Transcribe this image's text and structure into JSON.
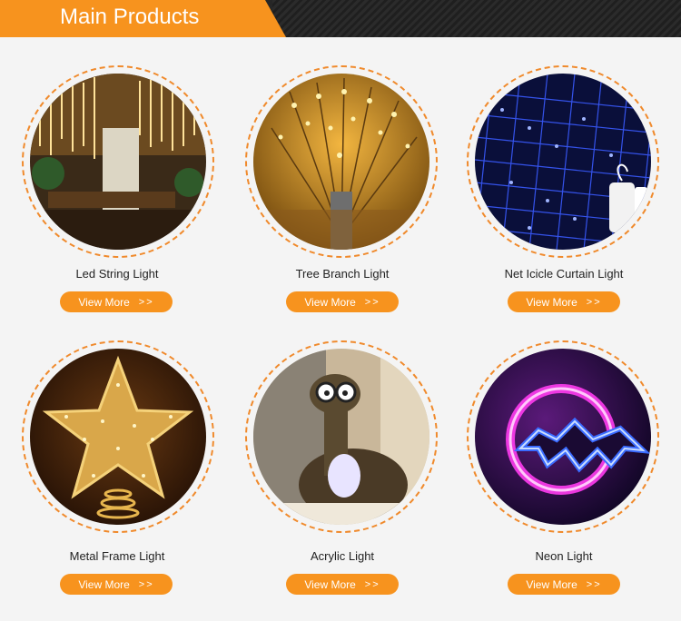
{
  "header": {
    "title": "Main Products"
  },
  "products": [
    {
      "name": "Led String Light",
      "button": "View More",
      "arrows": ">>"
    },
    {
      "name": "Tree Branch Light",
      "button": "View More",
      "arrows": ">>"
    },
    {
      "name": "Net Icicle Curtain Light",
      "button": "View More",
      "arrows": ">>"
    },
    {
      "name": "Metal Frame Light",
      "button": "View More",
      "arrows": ">>"
    },
    {
      "name": "Acrylic Light",
      "button": "View More",
      "arrows": ">>"
    },
    {
      "name": "Neon Light",
      "button": "View More",
      "arrows": ">>"
    }
  ],
  "colors": {
    "accent": "#f7931e",
    "header_bg": "#262626",
    "page_bg": "#f4f4f4"
  }
}
